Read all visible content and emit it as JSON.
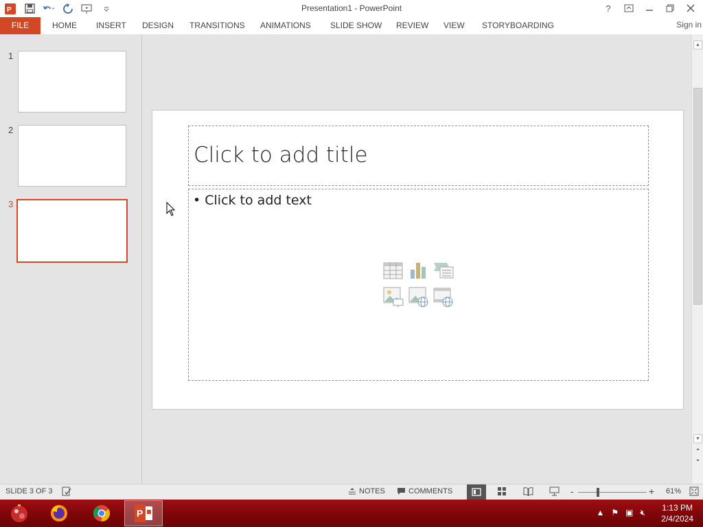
{
  "window": {
    "title": "Presentation1 - PowerPoint",
    "help_label": "?",
    "sign_in": "Sign in"
  },
  "ribbon": {
    "tabs": [
      "FILE",
      "HOME",
      "INSERT",
      "DESIGN",
      "TRANSITIONS",
      "ANIMATIONS",
      "SLIDE SHOW",
      "REVIEW",
      "VIEW",
      "STORYBOARDING"
    ]
  },
  "thumbnails": [
    {
      "number": "1",
      "active": false
    },
    {
      "number": "2",
      "active": false
    },
    {
      "number": "3",
      "active": true
    }
  ],
  "slide": {
    "title_placeholder": "Click to add title",
    "body_placeholder": "• Click to add text",
    "content_icons": [
      "table-icon",
      "chart-icon",
      "smartart-icon",
      "pictures-icon",
      "online-pictures-icon",
      "video-icon"
    ]
  },
  "statusbar": {
    "slide_indicator": "SLIDE 3 OF 3",
    "notes": "NOTES",
    "comments": "COMMENTS",
    "zoom_minus": "-",
    "zoom_plus": "+",
    "zoom": "61%"
  },
  "taskbar": {
    "apps": [
      "start-orb-icon",
      "firefox-icon",
      "chrome-icon",
      "powerpoint-icon"
    ],
    "time": "1:13 PM",
    "date": "2/4/2024"
  },
  "colors": {
    "accent": "#d24726",
    "taskbar": "#7b0508"
  }
}
